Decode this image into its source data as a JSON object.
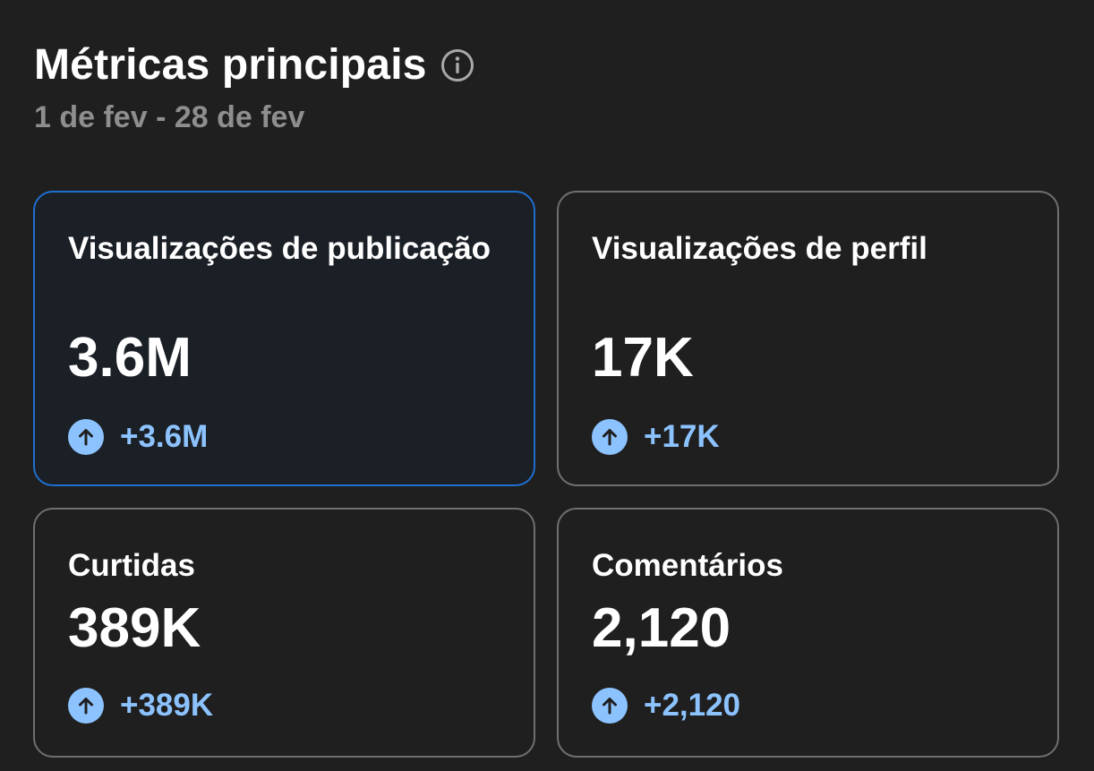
{
  "header": {
    "title": "Métricas principais",
    "info_icon": "info-icon",
    "date_range": "1 de fev - 28 de fev"
  },
  "colors": {
    "background": "#1f1f1f",
    "card_border": "#6f6f6f",
    "selected_border": "#1f6fcf",
    "accent_positive": "#8cc3ff",
    "subtitle": "#8e8e8e"
  },
  "metrics": [
    {
      "label": "Visualizações de publicação",
      "value": "3.6M",
      "change": "+3.6M",
      "change_icon": "arrow-up-icon",
      "selected": true
    },
    {
      "label": "Visualizações de perfil",
      "value": "17K",
      "change": "+17K",
      "change_icon": "arrow-up-icon",
      "selected": false
    },
    {
      "label": "Curtidas",
      "value": "389K",
      "change": "+389K",
      "change_icon": "arrow-up-icon",
      "selected": false
    },
    {
      "label": "Comentários",
      "value": "2,120",
      "change": "+2,120",
      "change_icon": "arrow-up-icon",
      "selected": false
    }
  ]
}
